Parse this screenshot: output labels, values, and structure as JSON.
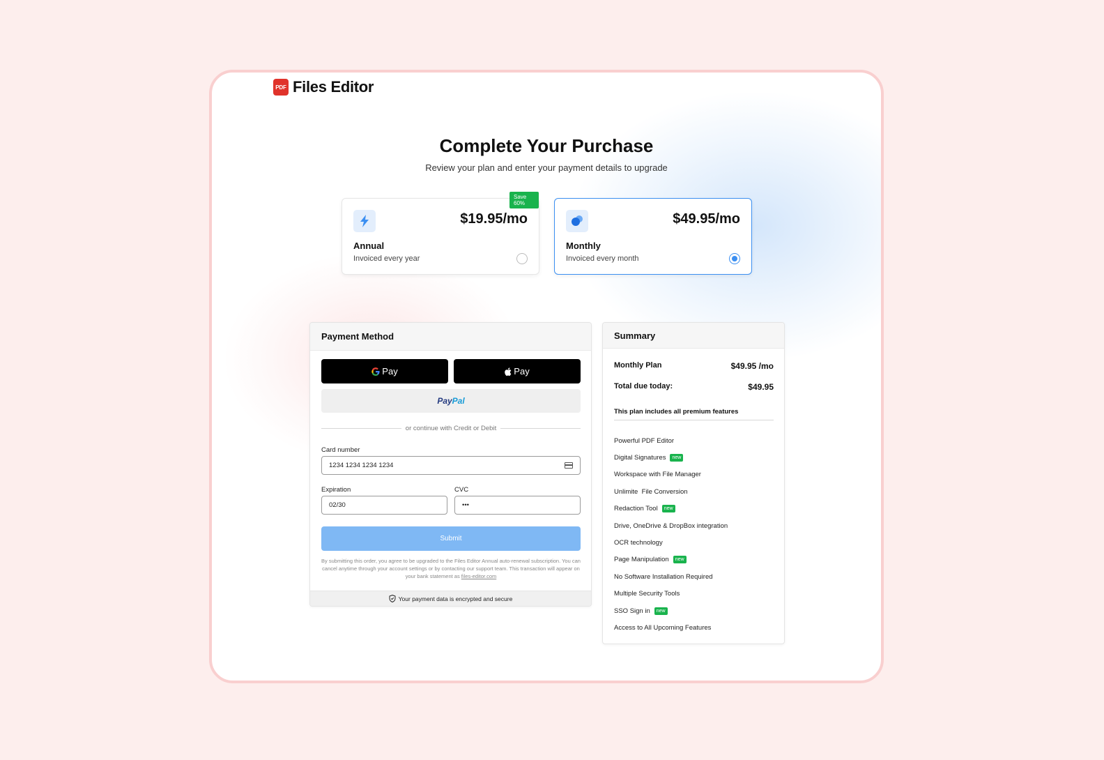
{
  "brand": {
    "badge": "PDF",
    "name": "Files Editor"
  },
  "hero": {
    "title": "Complete Your Purchase",
    "subtitle": "Review your plan and enter your payment details to upgrade"
  },
  "plans": [
    {
      "name": "Annual",
      "price": "$19.95/mo",
      "subtitle": "Invoiced every year",
      "badge": "Save 60%",
      "selected": false
    },
    {
      "name": "Monthly",
      "price": "$49.95/mo",
      "subtitle": "Invoiced every month",
      "selected": true
    }
  ],
  "payment": {
    "title": "Payment Method",
    "gpay_label": "Pay",
    "applepay_label": "Pay",
    "paypal_part1": "Pay",
    "paypal_part2": "Pal",
    "divider_text": "or continue with Credit or Debit",
    "card_number_label": "Card number",
    "card_number_value": "1234 1234 1234 1234",
    "expiration_label": "Expiration",
    "expiration_value": "02/30",
    "cvc_label": "CVC",
    "cvc_value": "•••",
    "submit_label": "Submit",
    "terms_text": "By submitting this order, you agree to be upgraded to the Files Editor Annual auto-renewal subscription. You can cancel anytime through your account settings or by contacting our support team. This transaction will appear on your bank statement as ",
    "terms_link": "files-editor.com",
    "secure_text": "Your payment data is encrypted and secure"
  },
  "summary": {
    "title": "Summary",
    "plan_label": "Monthly Plan",
    "plan_value": "$49.95 /mo",
    "total_label": "Total due today:",
    "total_value": "$49.95",
    "includes_note": "This plan includes all premium features",
    "features": [
      {
        "label": "Powerful PDF Editor",
        "new": false
      },
      {
        "label": "Digital Signatures",
        "new": true
      },
      {
        "label": "Workspace with File Manager",
        "new": false
      },
      {
        "label": "Unlimite  File Conversion",
        "new": false
      },
      {
        "label": "Redaction Tool",
        "new": true
      },
      {
        "label": "Drive, OneDrive & DropBox integration",
        "new": false
      },
      {
        "label": "OCR technology",
        "new": false
      },
      {
        "label": "Page Manipulation",
        "new": true
      },
      {
        "label": "No Software Installation Required",
        "new": false
      },
      {
        "label": "Multiple Security Tools",
        "new": false
      },
      {
        "label": "SSO Sign in",
        "new": true
      },
      {
        "label": "Access to All Upcoming Features",
        "new": false
      }
    ],
    "new_badge_label": "new"
  },
  "colors": {
    "accent": "#3b8ff1",
    "green": "#19b34d",
    "brand_red": "#e0332b",
    "submit_disabled": "#7fb8f4"
  }
}
